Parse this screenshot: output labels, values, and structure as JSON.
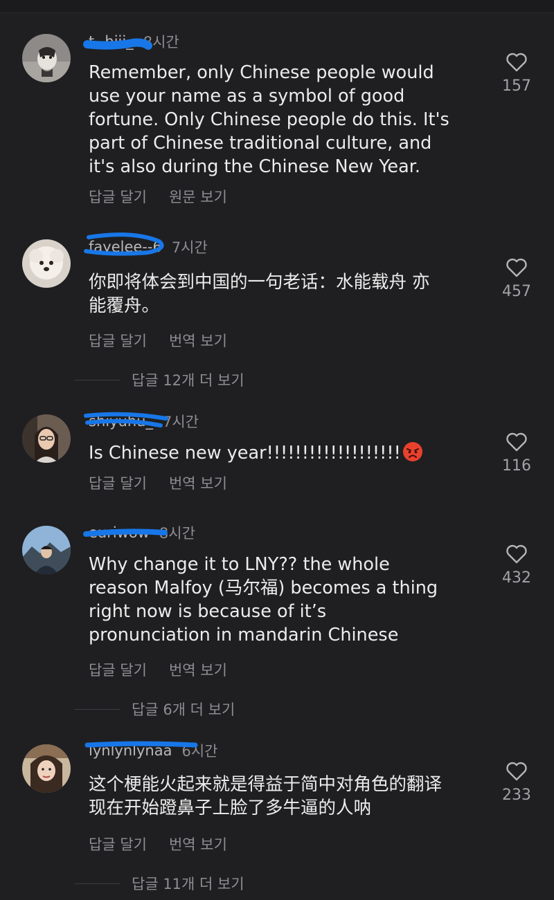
{
  "comments": [
    {
      "username": "t--hiii_",
      "time": "8시간",
      "text": "Remember, only Chinese people would\nuse your name as a symbol of good\nfortune. Only Chinese people do this. It's\npart of Chinese traditional culture, and\nit's also during the Chinese New Year.",
      "actions": [
        "답글 달기",
        "원문 보기"
      ],
      "likes": "157"
    },
    {
      "username": "fayelee--6",
      "time": "7시간",
      "text": "你即将体会到中国的一句老话：水能载舟 亦\n能覆舟。",
      "actions": [
        "답글 달기",
        "번역 보기"
      ],
      "likes": "457",
      "more_replies": "답글 12개 더 보기"
    },
    {
      "username": "shiyuhu_",
      "time": "7시간",
      "text": "Is Chinese new year!!!!!!!!!!!!!!!!!!!",
      "actions": [
        "답글 달기",
        "번역 보기"
      ],
      "likes": "116"
    },
    {
      "username": "euriwow",
      "time": "8시간",
      "text": "Why change it to LNY?? the whole\nreason Malfoy (马尔福) becomes a thing\nright now is because of it’s\npronunciation in mandarin Chinese",
      "actions": [
        "답글 달기",
        "번역 보기"
      ],
      "likes": "432",
      "more_replies": "답글 6개 더 보기"
    },
    {
      "username": "lynlynlynaa",
      "time": "6시간",
      "text": "这个梗能火起来就是得益于简中对角色的翻译\n现在开始蹬鼻子上脸了多牛逼的人呐",
      "actions": [
        "답글 달기",
        "번역 보기"
      ],
      "likes": "233",
      "more_replies": "답글 11개 더 보기"
    }
  ],
  "colors": {
    "background": "#1f1f21",
    "text": "#ececec",
    "secondary": "#8e8e93",
    "scribble": "#1877e8"
  }
}
